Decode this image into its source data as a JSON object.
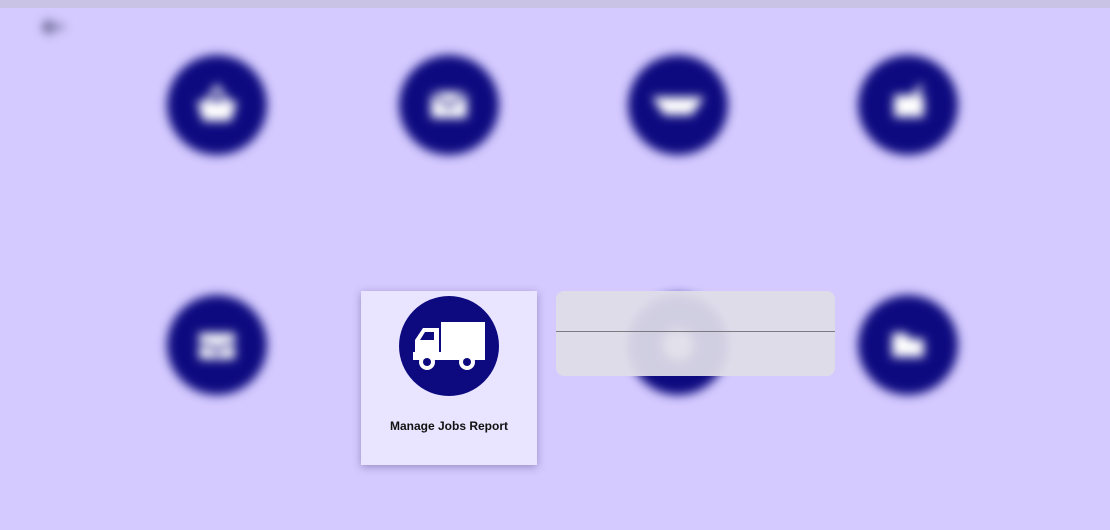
{
  "colors": {
    "background": "#d4caff",
    "icon_circle": "#0d0a80",
    "card": "#e9e4ff",
    "dropdown": "#e0dee8"
  },
  "header": {
    "back_icon": "back-arrow-icon"
  },
  "focused_tile": {
    "label": "Manage Jobs Report",
    "icon": "truck-icon"
  },
  "blurred_tiles": [
    {
      "icon": "basket-icon"
    },
    {
      "icon": "envelope-icon"
    },
    {
      "icon": "handshake-icon"
    },
    {
      "icon": "shopping-cart-icon"
    },
    {
      "icon": "inbox-icon"
    },
    {
      "icon": "pie-chart-icon"
    },
    {
      "icon": "folder-icon"
    }
  ],
  "dropdown": {
    "items": [
      "",
      ""
    ]
  }
}
